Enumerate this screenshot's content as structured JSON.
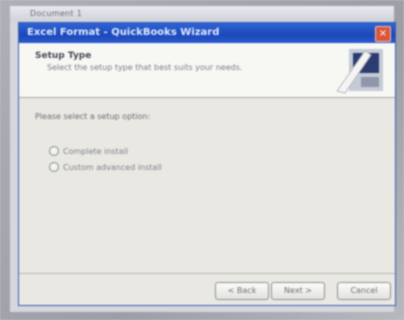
{
  "taskbar": {
    "label": "Document 1"
  },
  "window": {
    "title": "Excel Format - QuickBooks Wizard",
    "close_glyph": "×"
  },
  "header": {
    "title": "Setup Type",
    "subtitle": "Select the setup type that best suits your needs."
  },
  "content": {
    "prompt": "Please select a setup option:",
    "options": [
      {
        "label": "Complete install",
        "selected": false
      },
      {
        "label": "Custom advanced install",
        "selected": false
      }
    ]
  },
  "footer": {
    "back_label": "< Back",
    "next_label": "Next >",
    "cancel_label": "Cancel"
  },
  "colors": {
    "titlebar": "#1b48b8",
    "close": "#d9563b",
    "dialog_bg": "#e9e8e3"
  },
  "icons": {
    "wizard_art": "monitor-graphic-icon",
    "close": "close-icon"
  }
}
